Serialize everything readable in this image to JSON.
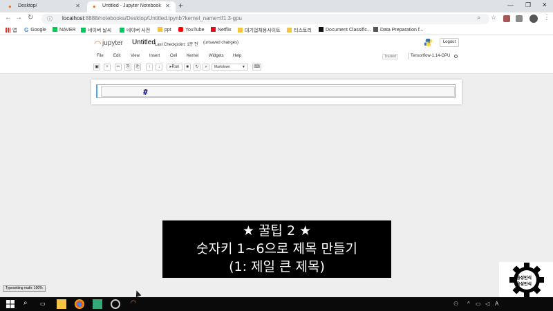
{
  "browser": {
    "tabs": [
      {
        "label": "Desktop/",
        "active": false
      },
      {
        "label": "Untitled - Jupyter Notebook",
        "active": true
      }
    ],
    "url_host": "localhost",
    "url_path": ":8888/notebooks/Desktop/Untitled.ipynb?kernel_name=tf1.3-gpu",
    "bookmarks": [
      {
        "label": "앱",
        "icon": "apps-grid-icon",
        "color": "#d93025"
      },
      {
        "label": "Google",
        "icon": "google-icon",
        "color": "#4285f4"
      },
      {
        "label": "NAVER",
        "icon": "naver-icon",
        "color": "#03c75a"
      },
      {
        "label": "네이버 날씨",
        "icon": "naver-icon",
        "color": "#03c75a"
      },
      {
        "label": "네이버 사전",
        "icon": "naver-icon",
        "color": "#03c75a"
      },
      {
        "label": "ppt",
        "icon": "folder-icon",
        "color": "#f4c542"
      },
      {
        "label": "YouTube",
        "icon": "youtube-icon",
        "color": "#ff0000"
      },
      {
        "label": "Netflix",
        "icon": "netflix-icon",
        "color": "#e50914"
      },
      {
        "label": "대기업채용사이트",
        "icon": "folder-icon",
        "color": "#f4c542"
      },
      {
        "label": "티스토리",
        "icon": "folder-icon",
        "color": "#f4c542"
      },
      {
        "label": "Document Classific...",
        "icon": "medium-icon",
        "color": "#111111"
      },
      {
        "label": "Data Preparation f...",
        "icon": "page-icon",
        "color": "#555555"
      }
    ]
  },
  "jupyter": {
    "logo": "jupyter",
    "notebook_title": "Untitled",
    "checkpoint": "Last Checkpoint: 1분 전",
    "unsaved": "(unsaved changes)",
    "logout": "Logout",
    "menu": [
      "File",
      "Edit",
      "View",
      "Insert",
      "Cell",
      "Kernel",
      "Widgets",
      "Help"
    ],
    "trusted": "Trusted",
    "kernel": "Tensorflow-1.14-GPU",
    "run_label": "Run",
    "cell_type": "Markdown",
    "cell_text": "#"
  },
  "caption": {
    "line1": "★ 꿀팁 2 ★",
    "line2": "숫자키 1~6으로 제목 만들기",
    "line3": "(1: 제일 큰 제목)"
  },
  "typesetting": "Typesetting math: 100%",
  "watermark_text": [
    "음성인식",
    "음성인식"
  ],
  "colors": {
    "accent_orange": "#f37626",
    "cell_border_blue": "#42a5f5",
    "markdown_text": "#000080"
  }
}
